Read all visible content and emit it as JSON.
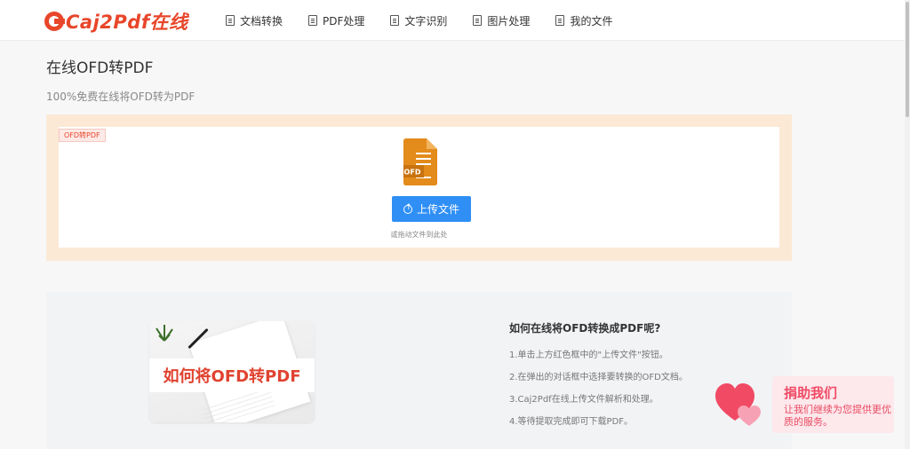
{
  "header": {
    "logo_text": "Caj2Pdf在线",
    "nav": [
      {
        "label": "文档转换",
        "icon": "document-convert-icon"
      },
      {
        "label": "PDF处理",
        "icon": "pdf-file-icon"
      },
      {
        "label": "文字识别",
        "icon": "text-recognition-icon"
      },
      {
        "label": "图片处理",
        "icon": "image-file-icon"
      },
      {
        "label": "我的文件",
        "icon": "my-files-icon"
      }
    ]
  },
  "page": {
    "title": "在线OFD转PDF",
    "subtitle": "100%免费在线将OFD转为PDF"
  },
  "upload": {
    "tag": "OFD转PDF",
    "file_icon_label": "OFD",
    "button_label": "上传文件",
    "hint": "或拖动文件到此处"
  },
  "howto": {
    "banner_text": "如何将OFD转PDF",
    "title": "如何在线将OFD转换成PDF呢?",
    "steps": [
      "1.单击上方红色框中的\"上传文件\"按钮。",
      "2.在弹出的对话框中选择要转换的OFD文档。",
      "3.Caj2Pdf在线上传文件解析和处理。",
      "4.等待提取完成即可下载PDF。"
    ]
  },
  "donate": {
    "title": "捐助我们",
    "text": "让我们继续为您提供更优质的服务。"
  },
  "colors": {
    "brand": "#e8462a",
    "upload_button": "#2f8ff5",
    "upload_frame": "#fbe9d6",
    "file_icon": "#e38b1b",
    "donate_pink": "#f04a64"
  }
}
